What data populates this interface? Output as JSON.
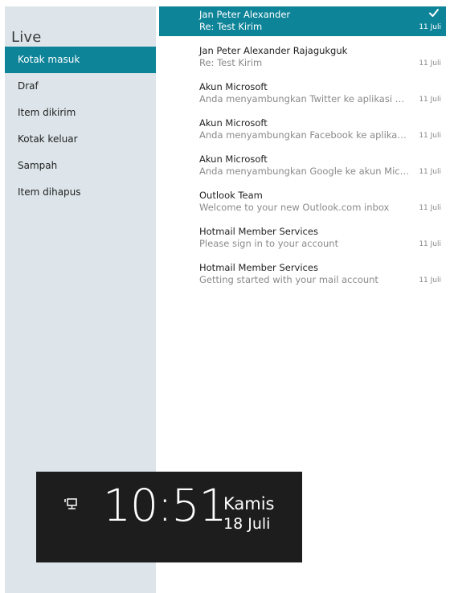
{
  "sidebar": {
    "account": "Live",
    "folders": [
      {
        "label": "Kotak masuk",
        "selected": true
      },
      {
        "label": "Draf"
      },
      {
        "label": "Item dikirim"
      },
      {
        "label": "Kotak keluar"
      },
      {
        "label": "Sampah"
      },
      {
        "label": "Item dihapus"
      }
    ]
  },
  "messages": [
    {
      "from": "Jan Peter Alexander",
      "subject": "Re: Test Kirim",
      "date": "11 Juli",
      "selected": true,
      "checked": true
    },
    {
      "from": "Jan Peter Alexander Rajagukguk",
      "subject": "Re: Test Kirim",
      "date": "11 Juli"
    },
    {
      "from": "Akun Microsoft",
      "subject": "Anda menyambungkan Twitter ke aplikasi Sosial",
      "date": "11 Juli"
    },
    {
      "from": "Akun Microsoft",
      "subject": "Anda menyambungkan Facebook ke aplikasi Sosial",
      "date": "11 Juli"
    },
    {
      "from": "Akun Microsoft",
      "subject": "Anda menyambungkan Google ke akun Microsoft",
      "date": "11 Juli"
    },
    {
      "from": "Outlook Team",
      "subject": "Welcome to your new Outlook.com inbox",
      "date": "11 Juli"
    },
    {
      "from": "Hotmail Member Services",
      "subject": "Please sign in to your account",
      "date": "11 Juli"
    },
    {
      "from": "Hotmail Member Services",
      "subject": "Getting started with your mail account",
      "date": "11 Juli"
    }
  ],
  "lock_screen": {
    "time": "10:51",
    "day": "Kamis",
    "date": "18 Juli",
    "network_icon": "network-wired-icon"
  },
  "colors": {
    "accent": "#0e8499",
    "sidebar_bg": "#dde5ea",
    "lock_bg": "#1d1d1d"
  }
}
